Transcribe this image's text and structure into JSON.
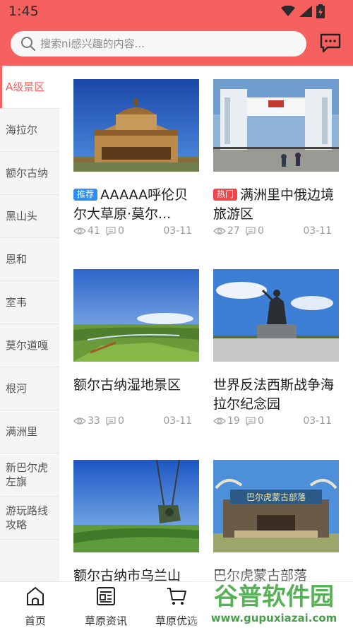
{
  "status_bar": {
    "time": "1:45"
  },
  "search": {
    "placeholder": "搜索ni感兴趣的内容..."
  },
  "sidebar": {
    "items": [
      {
        "label": "A级景区",
        "active": true
      },
      {
        "label": "海拉尔"
      },
      {
        "label": "额尔古纳"
      },
      {
        "label": "黑山头"
      },
      {
        "label": "恩和"
      },
      {
        "label": "室韦"
      },
      {
        "label": "莫尔道嘎"
      },
      {
        "label": "根河"
      },
      {
        "label": "满洲里"
      },
      {
        "label": "新巴尔虎左旗"
      },
      {
        "label": "游玩路线攻略"
      }
    ]
  },
  "cards": [
    {
      "tag": "推荐",
      "tag_color": "#2c8ff0",
      "title": "AAAAA呼伦贝尔大草原·莫尔...",
      "views": "41",
      "comments": "0",
      "date": "03-11"
    },
    {
      "tag": "热门",
      "tag_color": "#f0464a",
      "title": "满洲里中俄边境旅游区",
      "views": "27",
      "comments": "0",
      "date": "03-11"
    },
    {
      "title": "额尔古纳湿地景区",
      "views": "33",
      "comments": "0",
      "date": "03-11"
    },
    {
      "title": "世界反法西斯战争海拉尔纪念园",
      "views": "19",
      "comments": "0",
      "date": "03-11"
    },
    {
      "title": "额尔古纳市乌兰山"
    },
    {
      "title": "巴尔虎蒙古部落",
      "sign_text": "巴尔虎蒙古部落"
    }
  ],
  "bottom_nav": {
    "items": [
      {
        "label": "首页",
        "icon": "home-icon"
      },
      {
        "label": "草原资讯",
        "icon": "news-icon"
      },
      {
        "label": "草原优选",
        "icon": "cart-icon"
      }
    ]
  },
  "watermark": {
    "text": "谷普软件园",
    "url": "www.gupuxiazai.com"
  },
  "colors": {
    "accent": "#f6605e",
    "tag_blue": "#2c8ff0",
    "tag_red": "#f0464a"
  }
}
